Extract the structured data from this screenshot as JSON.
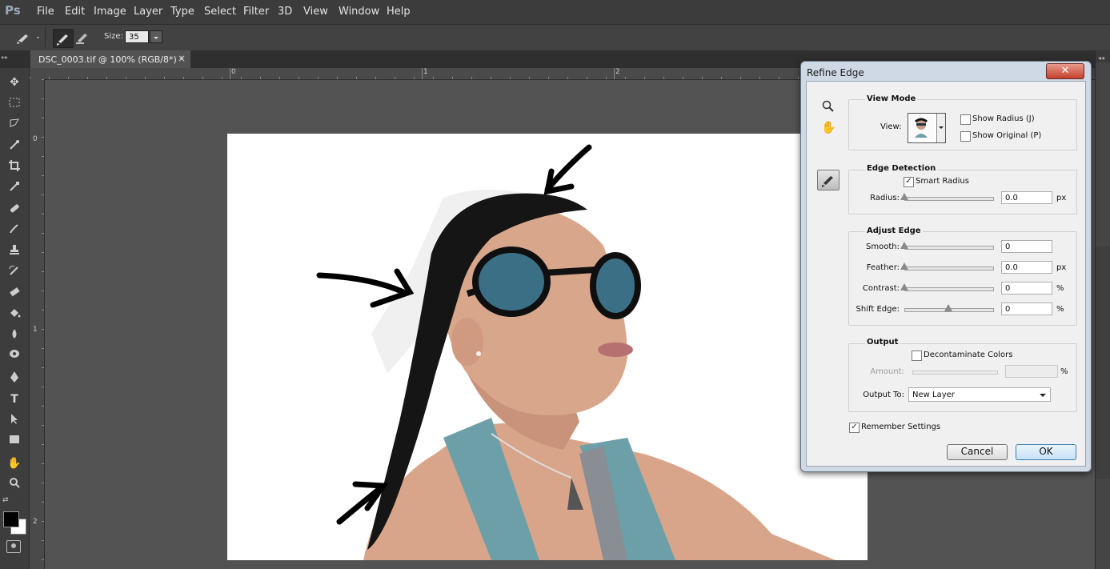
{
  "app": {
    "logo_text": "Ps",
    "menu": [
      "File",
      "Edit",
      "Image",
      "Layer",
      "Type",
      "Select",
      "Filter",
      "3D",
      "View",
      "Window",
      "Help"
    ]
  },
  "options_bar": {
    "size_label": "Size:",
    "size_value": "35"
  },
  "document": {
    "tab_title": "DSC_0003.tif @ 100% (RGB/8*) *",
    "close_glyph": "×"
  },
  "rulers": {
    "h_ticks": [
      "0",
      "1",
      "2"
    ],
    "v_ticks": [
      "0",
      "1",
      "2"
    ]
  },
  "dialog": {
    "title": "Refine Edge",
    "close_glyph": "✕",
    "view_mode": {
      "title": "View Mode",
      "view_label": "View:",
      "show_radius_label": "Show Radius (J)",
      "show_radius_checked": false,
      "show_original_label": "Show Original (P)",
      "show_original_checked": false
    },
    "edge_detection": {
      "title": "Edge Detection",
      "smart_radius_label": "Smart Radius",
      "smart_radius_checked": true,
      "radius_label": "Radius:",
      "radius_value": "0.0",
      "radius_unit": "px",
      "radius_level": 0
    },
    "adjust_edge": {
      "title": "Adjust Edge",
      "rows": [
        {
          "label": "Smooth:",
          "value": "0",
          "unit": "",
          "level": 0
        },
        {
          "label": "Feather:",
          "value": "0.0",
          "unit": "px",
          "level": 0
        },
        {
          "label": "Contrast:",
          "value": "0",
          "unit": "%",
          "level": 0
        },
        {
          "label": "Shift Edge:",
          "value": "0",
          "unit": "%",
          "level": 0.5
        }
      ]
    },
    "output": {
      "title": "Output",
      "decontaminate_label": "Decontaminate Colors",
      "decontaminate_checked": false,
      "amount_label": "Amount:",
      "amount_unit": "%",
      "output_to_label": "Output To:",
      "output_to_value": "New Layer"
    },
    "remember_label": "Remember Settings",
    "remember_checked": true,
    "cancel_label": "Cancel",
    "ok_label": "OK"
  }
}
